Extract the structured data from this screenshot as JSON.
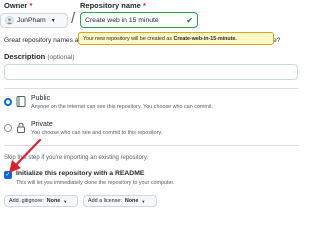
{
  "owner": {
    "label": "Owner",
    "required_mark": "*",
    "name": "JunPham"
  },
  "repo": {
    "label": "Repository name",
    "required_mark": "*",
    "value": "Create web in 15 minute",
    "available_hint_prefix": "Your new repository will be created as",
    "available_hint_name": "Create-web-in-15-minute."
  },
  "intro": {
    "text_start": "Great repository names a",
    "text_end": "ctored-waffle?"
  },
  "description": {
    "label": "Description",
    "optional": "(optional)",
    "value": ""
  },
  "visibility": {
    "public": {
      "title": "Public",
      "desc": "Anyone on the internet can see this repository. You choose who can commit."
    },
    "private": {
      "title": "Private",
      "desc": "You choose who can see and commit to this repository."
    }
  },
  "skip_note": "Skip this step if you're importing an existing repository.",
  "readme": {
    "label": "Initialize this repository with a README",
    "desc": "This will let you immediately clone the repository to your computer."
  },
  "gitignore": {
    "prefix": "Add .gitignore:",
    "value": "None"
  },
  "license": {
    "prefix": "Add a license:",
    "value": "None"
  },
  "colors": {
    "accent": "#0969da",
    "success": "#1a7f37",
    "arrow": "#d1242f"
  }
}
